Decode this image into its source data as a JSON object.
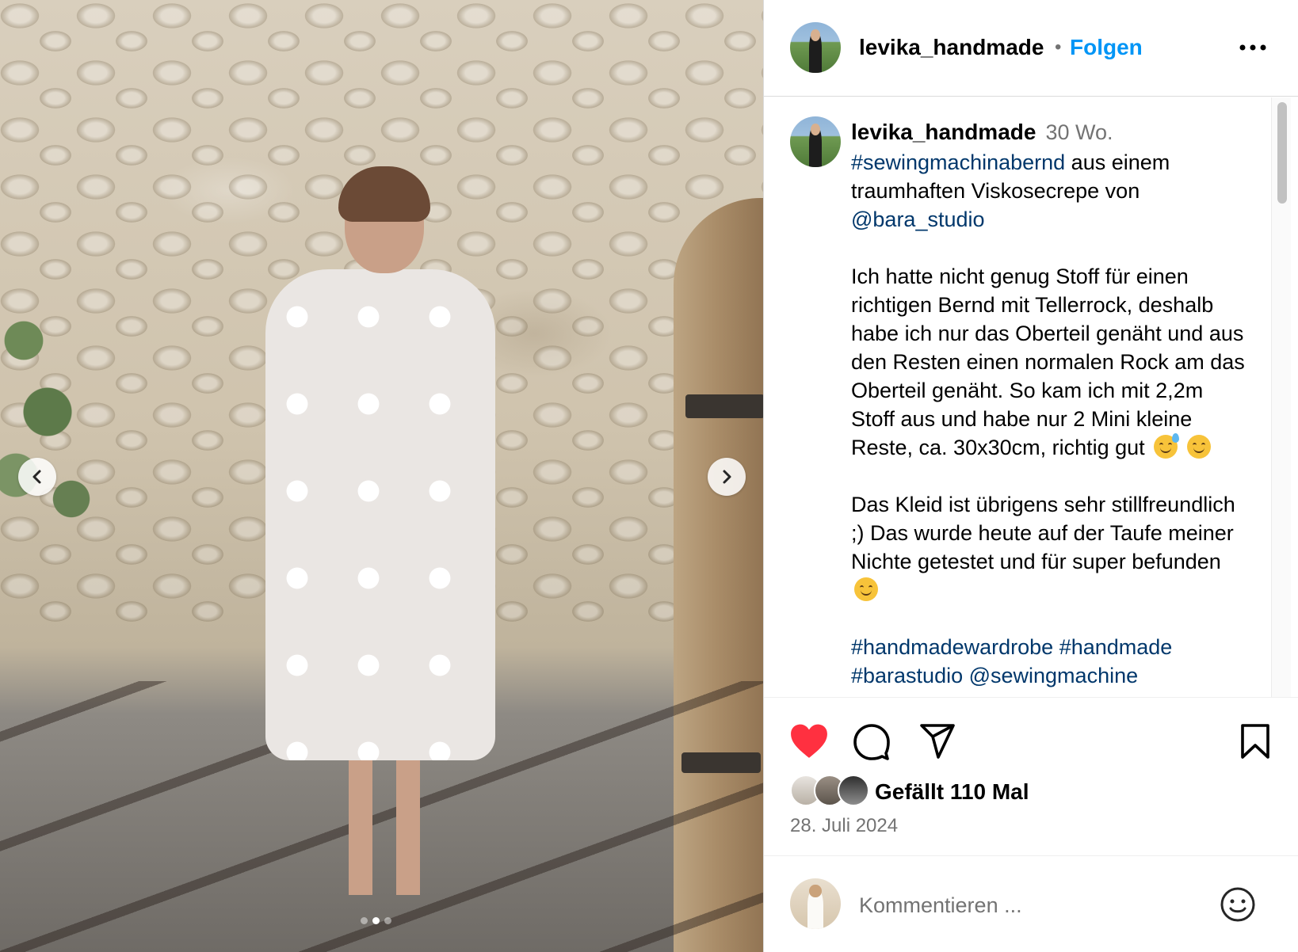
{
  "post": {
    "username": "levika_handmade",
    "separator": "•",
    "follow_label": "Folgen",
    "more_label": "Mehr Optionen"
  },
  "carousel": {
    "slide_count": 3,
    "active_index": 1
  },
  "caption": {
    "username": "levika_handmade",
    "time_ago": "30 Wo.",
    "line1_tag": "#sewingmachinabernd",
    "line1_rest": " aus einem traumhaften Viskosecrepe von ",
    "mention": "@bara_studio",
    "para2": "Ich hatte nicht genug Stoff für einen richtigen Bernd mit Tellerrock, deshalb habe ich nur das Oberteil genäht und aus den Resten einen normalen Rock am das Oberteil genäht. So kam ich mit 2,2m Stoff aus und habe nur 2 Mini kleine Reste, ca. 30x30cm, richtig gut",
    "para3": "Das Kleid ist übrigens sehr stillfreundlich ;) Das wurde heute auf der Taufe meiner Nichte getestet und für super befunden",
    "tag1": "#handmadewardrobe",
    "tag2": "#handmade",
    "tags_cut": "#barastudio @sewingmachine"
  },
  "engagement": {
    "likes_text": "Gefällt 110 Mal",
    "date": "28. Juli 2024",
    "liked": true
  },
  "comment": {
    "placeholder": "Kommentieren ..."
  },
  "colors": {
    "accent_blue": "#0095f6",
    "hashtag_blue": "#00376b",
    "like_red": "#ff3040",
    "muted_gray": "#737373"
  },
  "icons": [
    "chevron-left-icon",
    "chevron-right-icon",
    "more-icon",
    "heart-icon",
    "comment-icon",
    "share-icon",
    "bookmark-icon",
    "emoji-icon"
  ]
}
